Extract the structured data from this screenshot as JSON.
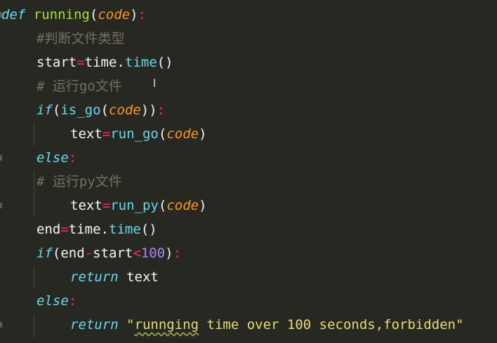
{
  "code": {
    "lines": [
      [
        {
          "t": "def",
          "c": "kw"
        },
        {
          "t": " ",
          "c": ""
        },
        {
          "t": "running",
          "c": "fn"
        },
        {
          "t": "(",
          "c": ""
        },
        {
          "t": "code",
          "c": "param"
        },
        {
          "t": ")",
          "c": ""
        },
        {
          "t": ":",
          "c": "op"
        }
      ],
      [
        {
          "t": "#判断文件类型",
          "c": "comment"
        }
      ],
      [
        {
          "t": "start",
          "c": ""
        },
        {
          "t": "=",
          "c": "op"
        },
        {
          "t": "time",
          "c": ""
        },
        {
          "t": ".",
          "c": ""
        },
        {
          "t": "time",
          "c": "call"
        },
        {
          "t": "()",
          "c": ""
        }
      ],
      [
        {
          "t": "# 运行go文件",
          "c": "comment"
        }
      ],
      [
        {
          "t": "if",
          "c": "kw"
        },
        {
          "t": "(",
          "c": ""
        },
        {
          "t": "is_go",
          "c": "call"
        },
        {
          "t": "(",
          "c": ""
        },
        {
          "t": "code",
          "c": "param"
        },
        {
          "t": "))",
          "c": ""
        },
        {
          "t": ":",
          "c": "op"
        }
      ],
      [
        {
          "t": "text",
          "c": ""
        },
        {
          "t": "=",
          "c": "op"
        },
        {
          "t": "run_go",
          "c": "call"
        },
        {
          "t": "(",
          "c": ""
        },
        {
          "t": "code",
          "c": "param"
        },
        {
          "t": ")",
          "c": ""
        }
      ],
      [
        {
          "t": "else",
          "c": "kw"
        },
        {
          "t": ":",
          "c": "op"
        }
      ],
      [
        {
          "t": "# 运行py文件",
          "c": "comment"
        }
      ],
      [
        {
          "t": "text",
          "c": ""
        },
        {
          "t": "=",
          "c": "op"
        },
        {
          "t": "run_py",
          "c": "call"
        },
        {
          "t": "(",
          "c": ""
        },
        {
          "t": "code",
          "c": "param"
        },
        {
          "t": ")",
          "c": ""
        }
      ],
      [
        {
          "t": "end",
          "c": ""
        },
        {
          "t": "=",
          "c": "op"
        },
        {
          "t": "time",
          "c": ""
        },
        {
          "t": ".",
          "c": ""
        },
        {
          "t": "time",
          "c": "call"
        },
        {
          "t": "()",
          "c": ""
        }
      ],
      [
        {
          "t": "if",
          "c": "kw"
        },
        {
          "t": "(",
          "c": ""
        },
        {
          "t": "end",
          "c": ""
        },
        {
          "t": "-",
          "c": "op"
        },
        {
          "t": "start",
          "c": ""
        },
        {
          "t": "<",
          "c": "op"
        },
        {
          "t": "100",
          "c": "num"
        },
        {
          "t": ")",
          "c": ""
        },
        {
          "t": ":",
          "c": "op"
        }
      ],
      [
        {
          "t": "return",
          "c": "kw"
        },
        {
          "t": " text",
          "c": ""
        }
      ],
      [
        {
          "t": "else",
          "c": "kw"
        },
        {
          "t": ":",
          "c": "op"
        }
      ],
      [
        {
          "t": "return",
          "c": "kw"
        },
        {
          "t": " ",
          "c": ""
        },
        {
          "t": "\"",
          "c": "str"
        },
        {
          "t": "runnging",
          "c": "str squiggle"
        },
        {
          "t": " time over 100 seconds,forbidden\"",
          "c": "str"
        }
      ]
    ]
  },
  "cursor": {
    "glyph": "I",
    "icon": "text-cursor-icon"
  },
  "colors": {
    "background": "#272822",
    "keyword": "#66d9ef",
    "function": "#a6e22e",
    "parameter": "#fd971f",
    "operator": "#f92672",
    "number": "#ae81ff",
    "string": "#e6db74",
    "comment": "#75715e",
    "text": "#f8f8f2"
  }
}
